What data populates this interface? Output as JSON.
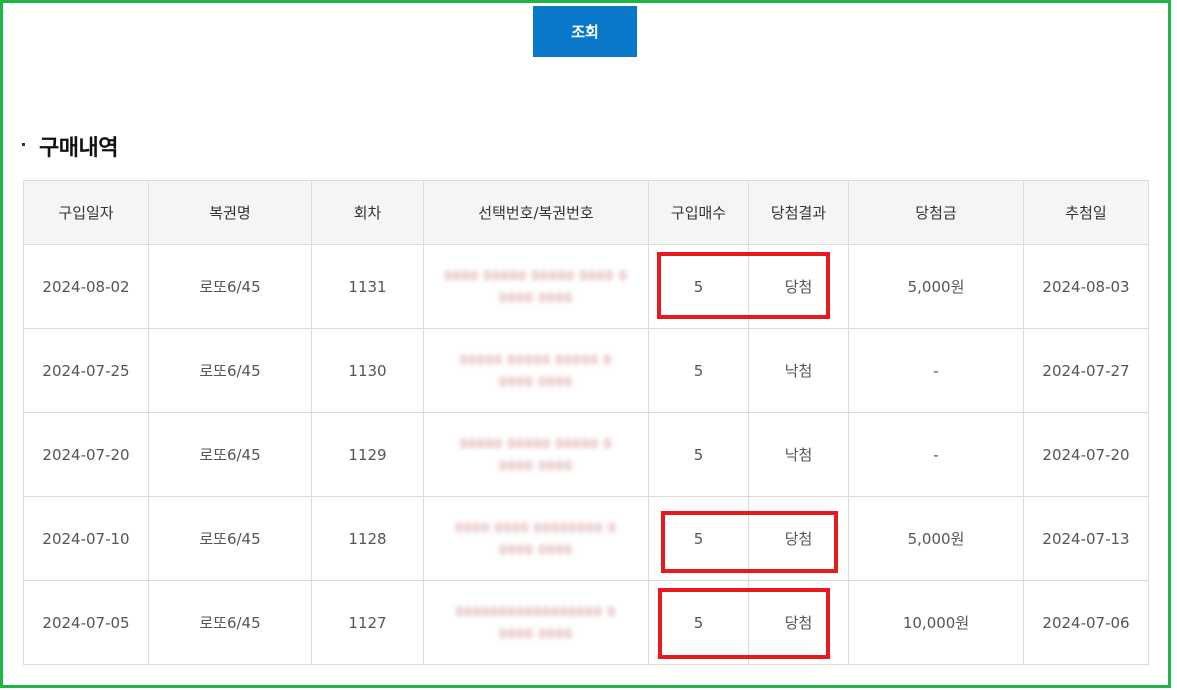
{
  "search": {
    "button_label": "조회"
  },
  "section": {
    "title": "구매내역"
  },
  "table": {
    "headers": [
      "구입일자",
      "복권명",
      "회차",
      "선택번호/복권번호",
      "구입매수",
      "당첨결과",
      "당첨금",
      "추첨일"
    ],
    "rows": [
      {
        "date": "2024-08-02",
        "name": "로또6/45",
        "round": "1131",
        "numbers_line1": "0000 00000 00000 0000 0",
        "numbers_line2": "0000 0000",
        "qty": "5",
        "result": "당첨",
        "prize": "5,000원",
        "draw_date": "2024-08-03"
      },
      {
        "date": "2024-07-25",
        "name": "로또6/45",
        "round": "1130",
        "numbers_line1": "00000 00000 00000 0",
        "numbers_line2": "0000 0000",
        "qty": "5",
        "result": "낙첨",
        "prize": "-",
        "draw_date": "2024-07-27"
      },
      {
        "date": "2024-07-20",
        "name": "로또6/45",
        "round": "1129",
        "numbers_line1": "00000 00000 00000 0",
        "numbers_line2": "0000 0000",
        "qty": "5",
        "result": "낙첨",
        "prize": "-",
        "draw_date": "2024-07-20"
      },
      {
        "date": "2024-07-10",
        "name": "로또6/45",
        "round": "1128",
        "numbers_line1": "0000 0000 00000000 0",
        "numbers_line2": "0000 0000",
        "qty": "5",
        "result": "당첨",
        "prize": "5,000원",
        "draw_date": "2024-07-13"
      },
      {
        "date": "2024-07-05",
        "name": "로또6/45",
        "round": "1127",
        "numbers_line1": "00000000000000000 0",
        "numbers_line2": "0000 0000",
        "qty": "5",
        "result": "당첨",
        "prize": "10,000원",
        "draw_date": "2024-07-06"
      }
    ]
  },
  "colors": {
    "frame": "#1db345",
    "button": "#0a78c8",
    "highlight": "#e8191c"
  }
}
